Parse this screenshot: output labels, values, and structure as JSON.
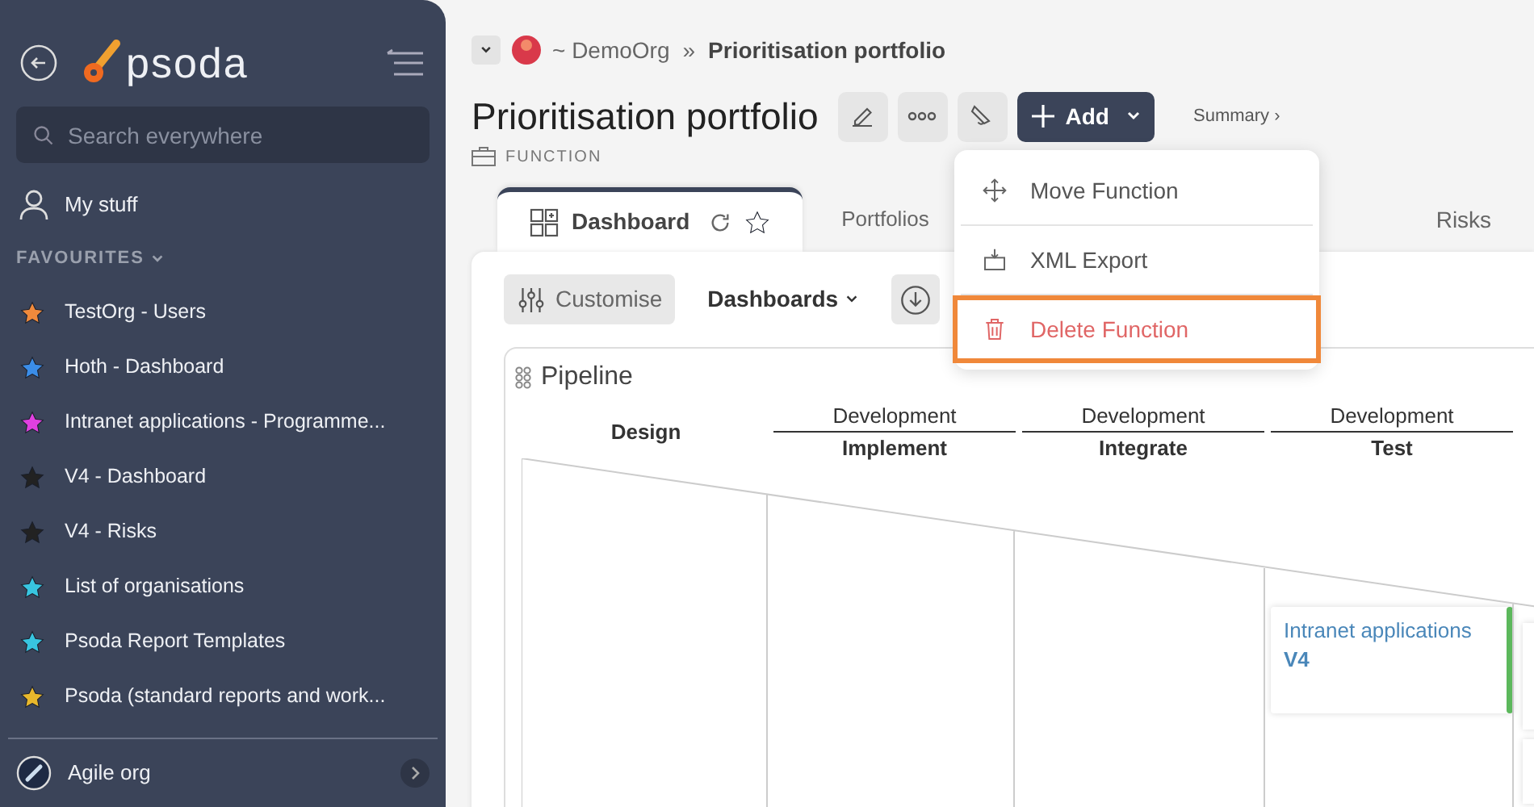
{
  "sidebar": {
    "logo": "psoda",
    "search": {
      "placeholder": "Search everywhere"
    },
    "my_stuff": "My stuff",
    "favourites_heading": "FAVOURITES",
    "expanded": true,
    "favourites": [
      {
        "label": "TestOrg - Users",
        "color": "#f08a3c"
      },
      {
        "label": "Hoth - Dashboard",
        "color": "#3b8de8"
      },
      {
        "label": "Intranet applications - Programme...",
        "color": "#e040e0"
      },
      {
        "label": "V4 - Dashboard",
        "color": "#222222"
      },
      {
        "label": "V4 - Risks",
        "color": "#222222"
      },
      {
        "label": "List of organisations",
        "color": "#38c5e0"
      },
      {
        "label": "Psoda Report Templates",
        "color": "#38c5e0"
      },
      {
        "label": "Psoda (standard reports and work...",
        "color": "#e8b82c"
      }
    ],
    "org": "Agile org"
  },
  "breadcrumb": {
    "org": "~ DemoOrg",
    "separator": "»",
    "current": "Prioritisation portfolio"
  },
  "title": "Prioritisation portfolio",
  "add_button": "Add",
  "summary_link": "Summary ›",
  "type_label": "FUNCTION",
  "tabs": [
    {
      "label": "Dashboard",
      "selected": true
    },
    {
      "label": "Portfolios",
      "selected": false
    },
    {
      "label": "Risks",
      "selected": false
    }
  ],
  "toolbar": {
    "customise": "Customise",
    "dashboards": "Dashboards"
  },
  "menu": [
    {
      "kind": "move",
      "label": "Move Function",
      "highlighted": false
    },
    {
      "kind": "export",
      "label": "XML Export",
      "highlighted": false
    },
    {
      "kind": "delete",
      "label": "Delete Function",
      "highlighted": true
    }
  ],
  "pipeline": {
    "title": "Pipeline",
    "columns": [
      {
        "label": "Design"
      },
      {
        "group": "Development",
        "label": "Implement"
      },
      {
        "group": "Development",
        "label": "Integrate"
      },
      {
        "group": "Development",
        "label": "Test",
        "cards": [
          {
            "name": "Intranet applications",
            "version": "V4",
            "color": "#5cb85c"
          }
        ]
      }
    ]
  }
}
